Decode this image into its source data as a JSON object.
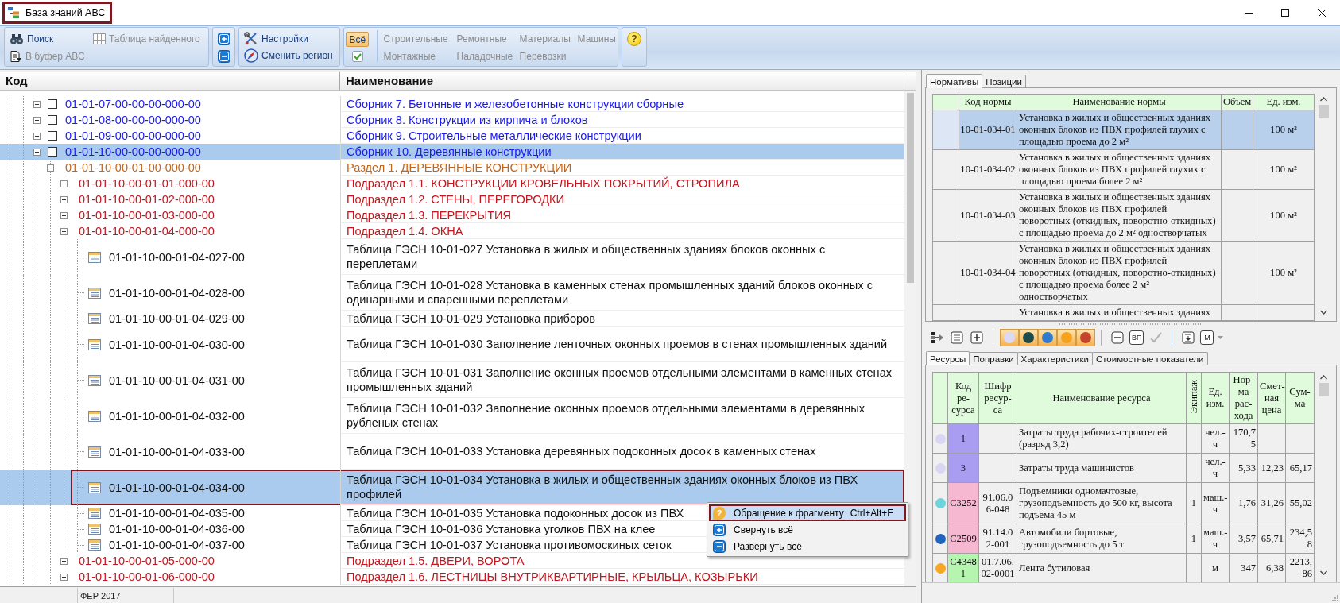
{
  "window": {
    "title": "База знаний АВС",
    "outlined": true
  },
  "toolbar": {
    "search_group": [
      {
        "label": "Поиск",
        "disabled": false
      },
      {
        "label": "Таблица найденного",
        "disabled": true
      },
      {
        "label": "В буфер АВС",
        "disabled": true
      }
    ],
    "settings_group": [
      {
        "label": "Настройки"
      },
      {
        "label": "Сменить регион"
      }
    ],
    "filters": [
      {
        "kind": "all",
        "label": "Всё",
        "selected": true
      },
      {
        "kind": "category",
        "label": "Строительные",
        "selected": false
      },
      {
        "kind": "category",
        "label": "Ремонтные",
        "selected": false
      },
      {
        "kind": "category",
        "label": "Материалы",
        "selected": false
      },
      {
        "kind": "category",
        "label": "Машины",
        "selected": false
      },
      {
        "kind": "category",
        "label": "Монтажные",
        "selected": false
      },
      {
        "kind": "category",
        "label": "Наладочные",
        "selected": false
      },
      {
        "kind": "category",
        "label": "Перевозки",
        "selected": false
      }
    ],
    "help": "?"
  },
  "tree": {
    "columns": [
      "Код",
      "Наименование"
    ],
    "items": [
      {
        "kind": "collection",
        "code": "01-01-07-00-00-00-000-00",
        "name": "Сборник 7. Бетонные и железобетонные конструкции сборные",
        "expanded": false,
        "checked": false,
        "selected": false
      },
      {
        "kind": "collection",
        "code": "01-01-08-00-00-00-000-00",
        "name": "Сборник 8. Конструкции из кирпича и блоков",
        "expanded": false,
        "checked": false,
        "selected": false
      },
      {
        "kind": "collection",
        "code": "01-01-09-00-00-00-000-00",
        "name": "Сборник 9. Строительные металлические конструкции",
        "expanded": false,
        "checked": false,
        "selected": false
      },
      {
        "kind": "collection",
        "code": "01-01-10-00-00-00-000-00",
        "name": "Сборник 10. Деревянные конструкции",
        "expanded": true,
        "checked": false,
        "selected": true,
        "children": [
          {
            "kind": "section",
            "code": "01-01-10-00-01-00-000-00",
            "name": "Раздел 1. ДЕРЕВЯННЫЕ КОНСТРУКЦИИ",
            "expanded": true,
            "selected": false,
            "children": [
              {
                "kind": "subsection",
                "code": "01-01-10-00-01-01-000-00",
                "name": "Подраздел 1.1. КОНСТРУКЦИИ КРОВЕЛЬНЫХ ПОКРЫТИЙ, СТРОПИЛА",
                "expanded": false,
                "selected": false
              },
              {
                "kind": "subsection",
                "code": "01-01-10-00-01-02-000-00",
                "name": "Подраздел 1.2. СТЕНЫ, ПЕРЕГОРОДКИ",
                "expanded": false,
                "selected": false
              },
              {
                "kind": "subsection",
                "code": "01-01-10-00-01-03-000-00",
                "name": "Подраздел 1.3. ПЕРЕКРЫТИЯ",
                "expanded": false,
                "selected": false
              },
              {
                "kind": "subsection",
                "code": "01-01-10-00-01-04-000-00",
                "name": "Подраздел 1.4. ОКНА",
                "expanded": true,
                "selected": false,
                "children": [
                  {
                    "kind": "table",
                    "code": "01-01-10-00-01-04-027-00",
                    "name": "Таблица ГЭСН 10-01-027 Установка в жилых и общественных зданиях блоков оконных с переплетами",
                    "selected": false,
                    "outlined": false
                  },
                  {
                    "kind": "table",
                    "code": "01-01-10-00-01-04-028-00",
                    "name": "Таблица ГЭСН 10-01-028 Установка в каменных стенах промышленных зданий блоков оконных с одинарными и спаренными переплетами",
                    "selected": false,
                    "outlined": false
                  },
                  {
                    "kind": "table",
                    "code": "01-01-10-00-01-04-029-00",
                    "name": "Таблица ГЭСН 10-01-029 Установка приборов",
                    "selected": false,
                    "outlined": false
                  },
                  {
                    "kind": "table",
                    "code": "01-01-10-00-01-04-030-00",
                    "name": "Таблица ГЭСН 10-01-030 Заполнение ленточных оконных проемов в стенах промышленных зданий",
                    "selected": false,
                    "outlined": false
                  },
                  {
                    "kind": "table",
                    "code": "01-01-10-00-01-04-031-00",
                    "name": "Таблица ГЭСН 10-01-031 Заполнение оконных проемов отдельными элементами в каменных стенах промышленных зданий",
                    "selected": false,
                    "outlined": false
                  },
                  {
                    "kind": "table",
                    "code": "01-01-10-00-01-04-032-00",
                    "name": "Таблица ГЭСН 10-01-032 Заполнение оконных проемов отдельными элементами в деревянных рубленых стенах",
                    "selected": false,
                    "outlined": false
                  },
                  {
                    "kind": "table",
                    "code": "01-01-10-00-01-04-033-00",
                    "name": "Таблица ГЭСН 10-01-033 Установка деревянных подоконных досок в каменных стенах",
                    "selected": false,
                    "outlined": false
                  },
                  {
                    "kind": "table",
                    "code": "01-01-10-00-01-04-034-00",
                    "name": "Таблица ГЭСН 10-01-034 Установка в жилых и общественных зданиях оконных блоков из ПВХ профилей",
                    "selected": true,
                    "outlined": true
                  },
                  {
                    "kind": "table",
                    "code": "01-01-10-00-01-04-035-00",
                    "name": "Таблица ГЭСН 10-01-035 Установка подоконных досок из ПВХ",
                    "selected": false,
                    "outlined": false
                  },
                  {
                    "kind": "table",
                    "code": "01-01-10-00-01-04-036-00",
                    "name": "Таблица ГЭСН 10-01-036 Установка уголков ПВХ на клее",
                    "selected": false,
                    "outlined": false
                  },
                  {
                    "kind": "table",
                    "code": "01-01-10-00-01-04-037-00",
                    "name": "Таблица ГЭСН 10-01-037 Установка противомоскиных сеток",
                    "selected": false,
                    "outlined": false
                  }
                ]
              },
              {
                "kind": "subsection",
                "code": "01-01-10-00-01-05-000-00",
                "name": "Подраздел 1.5. ДВЕРИ, ВОРОТА",
                "expanded": false,
                "selected": false
              },
              {
                "kind": "subsection",
                "code": "01-01-10-00-01-06-000-00",
                "name": "Подраздел 1.6. ЛЕСТНИЦЫ ВНУТРИКВАРТИРНЫЕ, КРЫЛЬЦА, КОЗЫРЬКИ",
                "expanded": false,
                "selected": false
              }
            ]
          }
        ]
      }
    ]
  },
  "context_menu": [
    {
      "icon_glyph": "?",
      "label": "Обращение к фрагменту",
      "shortcut": "Ctrl+Alt+F",
      "selected": true,
      "outlined": true
    },
    {
      "label": "Свернуть всё",
      "selected": false,
      "outlined": false
    },
    {
      "label": "Развернуть всё",
      "selected": false,
      "outlined": false
    }
  ],
  "status_bar": [
    "ФЕР 2017"
  ],
  "norm_tabs": [
    {
      "label": "Нормативы",
      "selected": true
    },
    {
      "label": "Позиции",
      "selected": false
    }
  ],
  "norms_table": {
    "columns": [
      "Код нормы",
      "Наименование нормы",
      "Объем",
      "Ед. изм."
    ],
    "rows": [
      {
        "code": "10-01-034-01",
        "name": "Установка в жилых и общественных зданиях оконных блоков из ПВХ профилей глухих с площадью проема до 2 м²",
        "unit": "100 м²",
        "selected": true
      },
      {
        "code": "10-01-034-02",
        "name": "Установка в жилых и общественных зданиях оконных блоков из ПВХ профилей глухих с площадью проема более 2 м²",
        "unit": "100 м²",
        "selected": false
      },
      {
        "code": "10-01-034-03",
        "name": "Установка в жилых и общественных зданиях оконных блоков из ПВХ профилей поворотных (откидных, поворотно-откидных) с площадью проема до 2 м² одностворчатых",
        "unit": "100 м²",
        "selected": false
      },
      {
        "code": "10-01-034-04",
        "name": "Установка в жилых и общественных зданиях оконных блоков из ПВХ профилей поворотных (откидных, поворотно-откидных) с площадью проема более 2 м² одностворчатых",
        "unit": "100 м²",
        "selected": false
      },
      {
        "name": "Установка в жилых и общественных зданиях",
        "selected": false
      }
    ]
  },
  "resource_toolbar": [
    {
      "kind": "tool",
      "disabled": false
    },
    {
      "kind": "tool",
      "disabled": false
    },
    {
      "kind": "tool",
      "disabled": false
    },
    {
      "kind": "separator"
    },
    {
      "kind": "color",
      "color": "#dcd9f4",
      "on": true
    },
    {
      "kind": "color",
      "color": "#1d4a4a",
      "on": true
    },
    {
      "kind": "color",
      "color": "#2f7bd0",
      "on": true
    },
    {
      "kind": "color",
      "color": "#f5a21e",
      "on": true
    },
    {
      "kind": "color",
      "color": "#c4452c",
      "on": true
    },
    {
      "kind": "separator"
    },
    {
      "kind": "tool",
      "disabled": false
    },
    {
      "kind": "text",
      "label": "ВП",
      "disabled": false
    },
    {
      "kind": "tool",
      "disabled": true
    },
    {
      "kind": "separator"
    },
    {
      "kind": "tool",
      "disabled": false
    },
    {
      "kind": "text",
      "label": "М",
      "disabled": false
    },
    {
      "kind": "dropdown"
    }
  ],
  "resource_tabs": [
    {
      "label": "Ресурсы",
      "selected": true
    },
    {
      "label": "Поправки",
      "selected": false
    },
    {
      "label": "Характеристики",
      "selected": false
    },
    {
      "label": "Стоимостные показатели",
      "selected": false
    }
  ],
  "resources_table": {
    "columns": [
      "Код ре-сурса",
      "Шифр ресур-са",
      "Наименование ресурса",
      "Экипаж",
      "Ед. изм.",
      "Нор-ма рас-хода",
      "Смет-ная цена",
      "Сум-ма"
    ],
    "rows": [
      {
        "color": "#d9d6f3",
        "code": {
          "text": "1",
          "color": "#a99df2"
        },
        "name": "Затраты труда рабочих-строителей (разряд 3,2)",
        "unit": "чел.-ч",
        "norm": "170,75"
      },
      {
        "color": "#d9d6f3",
        "code": {
          "text": "3",
          "color": "#a99df2"
        },
        "name": "Затраты труда машинистов",
        "unit": "чел.-ч",
        "norm": "5,33",
        "price": "12,23",
        "sum": "65,17"
      },
      {
        "color": "#6dd3dc",
        "code": {
          "text": "С3252",
          "color": "#f6b8d0"
        },
        "cipher": "91.06.06-048",
        "name": "Подъемники одномачтовые, грузоподъемность до 500 кг, высота подъема 45 м",
        "crew": "1",
        "unit": "маш.-ч",
        "norm": "1,76",
        "price": "31,26",
        "sum": "55,02"
      },
      {
        "color": "#1f64c0",
        "code": {
          "text": "С2509",
          "color": "#f6b8d0"
        },
        "cipher": "91.14.02-001",
        "name": "Автомобили бортовые, грузоподъемность до 5 т",
        "crew": "1",
        "unit": "маш.-ч",
        "norm": "3,57",
        "price": "65,71",
        "sum": "234,58"
      },
      {
        "color": "#f6a623",
        "code": {
          "text": "С43481",
          "color": "#b6f5b0"
        },
        "cipher": "01.7.06.02-0001",
        "name": "Лента бутиловая",
        "unit": "м",
        "norm": "347",
        "price": "6,38",
        "sum": "2213,86"
      }
    ]
  }
}
